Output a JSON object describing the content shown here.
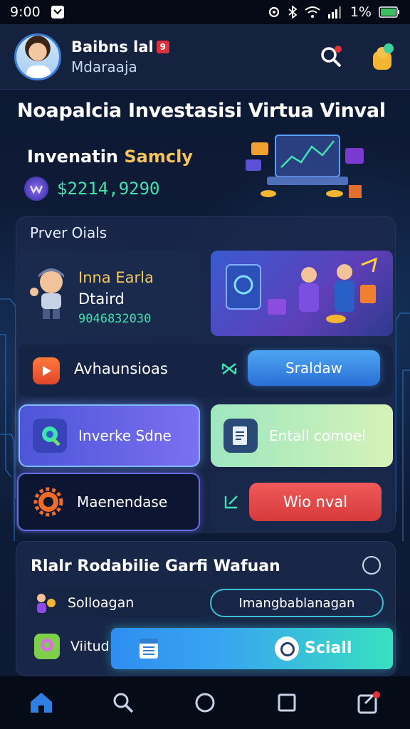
{
  "status_bar": {
    "time": "9:00",
    "battery": "1%"
  },
  "header": {
    "user_name": "Baibns lal",
    "user_badge": "9",
    "user_subtitle": "Mdaraaja"
  },
  "page": {
    "title": "Noapalcia Investasisi Virtua Vinval",
    "balance_label_a": "Invenatin ",
    "balance_label_b": "Samcly",
    "balance_value": "$2214,9290"
  },
  "overview": {
    "title": "Prver Oials",
    "user_card": {
      "line1": "Inna Earla",
      "line2": "Dtaird",
      "line3": "9046832030"
    },
    "play_row_label": "Avhaunsioas",
    "play_row_button": "Sraldaw",
    "tiles": {
      "invest": "Inverke Sdne",
      "email": "Entall comoel",
      "maintenance": "Maenendase",
      "withdraw": "Wio nval"
    }
  },
  "social": {
    "title": "Rlalr Rodabilie Garfi Wafuan",
    "row1_label": "Solloagan",
    "row1_button": "Imangbablanagan",
    "row2_label": "Viitud",
    "cta_label": "Sciall"
  },
  "nav": [
    "home-icon",
    "search-icon",
    "circle-icon",
    "square-icon",
    "share-icon"
  ],
  "colors": {
    "accent_green": "#3fe3b0",
    "accent_gold": "#f3c45a",
    "accent_blue": "#2a6fd6",
    "accent_red": "#d63a3a"
  }
}
